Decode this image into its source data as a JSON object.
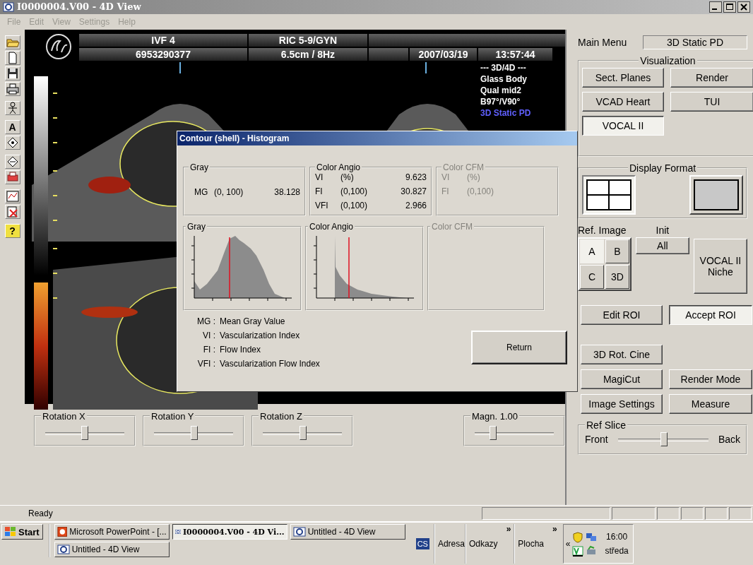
{
  "window": {
    "title": "I0000004.V00 - 4D View"
  },
  "menu": [
    {
      "label": "File",
      "disabled": true
    },
    {
      "label": "Edit",
      "disabled": true
    },
    {
      "label": "View",
      "disabled": true
    },
    {
      "label": "Settings",
      "disabled": true
    },
    {
      "label": "Help",
      "disabled": true
    }
  ],
  "toolbar": {
    "text_tool": "A",
    "help": "?"
  },
  "image": {
    "row_1": [
      "IVF 4",
      "RIC 5-9/GYN"
    ],
    "row_2": [
      "6953290377",
      "6.5cm / 8Hz",
      "2007/03/19",
      "13:57:44"
    ],
    "info_lines": [
      {
        "text": "--- 3D/4D ---",
        "kind": "normal"
      },
      {
        "text": "Glass Body",
        "kind": "normal"
      },
      {
        "text": "Qual mid2",
        "kind": "normal"
      },
      {
        "text": "B97°/V90°",
        "kind": "normal"
      },
      {
        "text": "3D Static PD",
        "kind": "highlight"
      }
    ]
  },
  "sliders": [
    {
      "label": "Rotation X",
      "level": 0.5
    },
    {
      "label": "Rotation Y",
      "level": 0.51
    },
    {
      "label": "Rotation Z",
      "level": 0.51
    }
  ],
  "magnification": {
    "label": "Magn. 1.00",
    "level": 0.23
  },
  "dialog": {
    "title": "Contour (shell) - Histogram",
    "stat_groups": [
      {
        "title": "Gray",
        "disabled": false,
        "kind": "single",
        "rows": [
          {
            "name": "MG",
            "range": "(0, 100)",
            "value": "38.128"
          }
        ]
      },
      {
        "title": "Color Angio",
        "disabled": false,
        "kind": "list",
        "rows": [
          {
            "name": "VI",
            "range": "(%)",
            "value": "9.623"
          },
          {
            "name": "FI",
            "range": "(0,100)",
            "value": "30.827"
          },
          {
            "name": "VFI",
            "range": "(0,100)",
            "value": "2.966"
          }
        ]
      },
      {
        "title": "Color CFM",
        "disabled": true,
        "kind": "list",
        "rows": [
          {
            "name": "VI",
            "range": "(%)"
          },
          {
            "name": "FI",
            "range": "(0,100)"
          }
        ]
      }
    ],
    "histograms": [
      {
        "title": "Gray",
        "disabled": false,
        "kind": "gray"
      },
      {
        "title": "Color Angio",
        "disabled": false,
        "kind": "angio"
      },
      {
        "title": "Color CFM",
        "disabled": true,
        "kind": "empty"
      }
    ],
    "legend": [
      {
        "abbr": "MG :",
        "text": "Mean Gray Value"
      },
      {
        "abbr": "VI :",
        "text": "Vascularization Index"
      },
      {
        "abbr": "FI :",
        "text": "Flow Index"
      },
      {
        "abbr": "VFI :",
        "text": "Vascularization Flow Index"
      }
    ],
    "button": "Return"
  },
  "right_panel": {
    "main_menu_label": "Main Menu",
    "mode": "3D Static PD",
    "visualization": {
      "title": "Visualization",
      "buttons": [
        {
          "label": "Sect. Planes",
          "selected": false
        },
        {
          "label": "Render",
          "selected": false
        },
        {
          "label": "VCAD Heart",
          "selected": false
        },
        {
          "label": "TUI",
          "selected": false
        },
        {
          "label": "VOCAL II",
          "selected": true
        }
      ]
    },
    "display_format": {
      "title": "Display Format",
      "layouts": [
        {
          "kind": "quad",
          "selected": true
        },
        {
          "kind": "single",
          "selected": false
        }
      ]
    },
    "ref_image": {
      "title": "Ref. Image",
      "buttons": [
        {
          "label": "A",
          "selected": true
        },
        {
          "label": "B",
          "selected": false
        },
        {
          "label": "C",
          "selected": false
        },
        {
          "label": "3D",
          "selected": false
        }
      ]
    },
    "init": {
      "title": "Init",
      "button": "All"
    },
    "niche_button": "VOCAL II\nNiche",
    "roi_buttons": [
      {
        "label": "Edit ROI",
        "selected": false
      },
      {
        "label": "Accept ROI",
        "selected": true
      }
    ],
    "tool_rows": [
      [
        "3D Rot. Cine"
      ],
      [
        "MagiCut",
        "Render Mode"
      ],
      [
        "Image Settings",
        "Measure"
      ]
    ],
    "ref_slice": {
      "title": "Ref Slice",
      "left": "Front",
      "right": "Back",
      "level": 0.51
    }
  },
  "status_bar": {
    "text": "Ready"
  },
  "taskbar": {
    "start": "Start",
    "tasks": [
      {
        "label": "Microsoft PowerPoint - [...",
        "selected": false,
        "kind": "presentation"
      },
      {
        "label": "I0000004.V00 - 4D Vi...",
        "selected": true,
        "kind": "viewer"
      },
      {
        "label": "Untitled - 4D View",
        "selected": false,
        "kind": "viewer"
      },
      {
        "label": "Untitled - 4D View",
        "selected": false,
        "kind": "viewer"
      }
    ],
    "language": "CS",
    "toolbars": [
      {
        "label": "Adresa"
      },
      {
        "label": "Odkazy",
        "chevron": "»"
      },
      {
        "label": "Plocha",
        "chevron": "»"
      }
    ],
    "tray_expand": "«",
    "clock": "16:00",
    "day": "středa"
  }
}
